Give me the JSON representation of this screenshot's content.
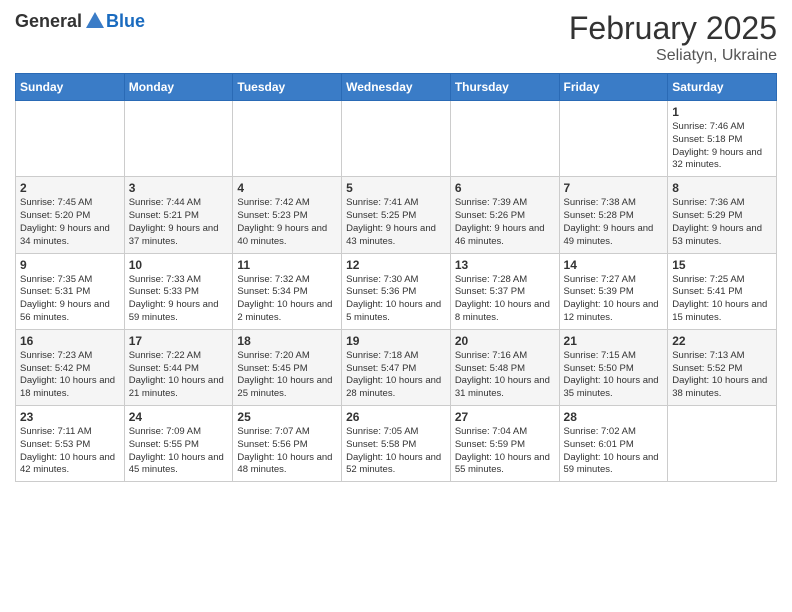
{
  "header": {
    "logo_general": "General",
    "logo_blue": "Blue",
    "title": "February 2025",
    "subtitle": "Seliatyn, Ukraine"
  },
  "days_of_week": [
    "Sunday",
    "Monday",
    "Tuesday",
    "Wednesday",
    "Thursday",
    "Friday",
    "Saturday"
  ],
  "weeks": [
    [
      {
        "day": "",
        "info": ""
      },
      {
        "day": "",
        "info": ""
      },
      {
        "day": "",
        "info": ""
      },
      {
        "day": "",
        "info": ""
      },
      {
        "day": "",
        "info": ""
      },
      {
        "day": "",
        "info": ""
      },
      {
        "day": "1",
        "info": "Sunrise: 7:46 AM\nSunset: 5:18 PM\nDaylight: 9 hours and 32 minutes."
      }
    ],
    [
      {
        "day": "2",
        "info": "Sunrise: 7:45 AM\nSunset: 5:20 PM\nDaylight: 9 hours and 34 minutes."
      },
      {
        "day": "3",
        "info": "Sunrise: 7:44 AM\nSunset: 5:21 PM\nDaylight: 9 hours and 37 minutes."
      },
      {
        "day": "4",
        "info": "Sunrise: 7:42 AM\nSunset: 5:23 PM\nDaylight: 9 hours and 40 minutes."
      },
      {
        "day": "5",
        "info": "Sunrise: 7:41 AM\nSunset: 5:25 PM\nDaylight: 9 hours and 43 minutes."
      },
      {
        "day": "6",
        "info": "Sunrise: 7:39 AM\nSunset: 5:26 PM\nDaylight: 9 hours and 46 minutes."
      },
      {
        "day": "7",
        "info": "Sunrise: 7:38 AM\nSunset: 5:28 PM\nDaylight: 9 hours and 49 minutes."
      },
      {
        "day": "8",
        "info": "Sunrise: 7:36 AM\nSunset: 5:29 PM\nDaylight: 9 hours and 53 minutes."
      }
    ],
    [
      {
        "day": "9",
        "info": "Sunrise: 7:35 AM\nSunset: 5:31 PM\nDaylight: 9 hours and 56 minutes."
      },
      {
        "day": "10",
        "info": "Sunrise: 7:33 AM\nSunset: 5:33 PM\nDaylight: 9 hours and 59 minutes."
      },
      {
        "day": "11",
        "info": "Sunrise: 7:32 AM\nSunset: 5:34 PM\nDaylight: 10 hours and 2 minutes."
      },
      {
        "day": "12",
        "info": "Sunrise: 7:30 AM\nSunset: 5:36 PM\nDaylight: 10 hours and 5 minutes."
      },
      {
        "day": "13",
        "info": "Sunrise: 7:28 AM\nSunset: 5:37 PM\nDaylight: 10 hours and 8 minutes."
      },
      {
        "day": "14",
        "info": "Sunrise: 7:27 AM\nSunset: 5:39 PM\nDaylight: 10 hours and 12 minutes."
      },
      {
        "day": "15",
        "info": "Sunrise: 7:25 AM\nSunset: 5:41 PM\nDaylight: 10 hours and 15 minutes."
      }
    ],
    [
      {
        "day": "16",
        "info": "Sunrise: 7:23 AM\nSunset: 5:42 PM\nDaylight: 10 hours and 18 minutes."
      },
      {
        "day": "17",
        "info": "Sunrise: 7:22 AM\nSunset: 5:44 PM\nDaylight: 10 hours and 21 minutes."
      },
      {
        "day": "18",
        "info": "Sunrise: 7:20 AM\nSunset: 5:45 PM\nDaylight: 10 hours and 25 minutes."
      },
      {
        "day": "19",
        "info": "Sunrise: 7:18 AM\nSunset: 5:47 PM\nDaylight: 10 hours and 28 minutes."
      },
      {
        "day": "20",
        "info": "Sunrise: 7:16 AM\nSunset: 5:48 PM\nDaylight: 10 hours and 31 minutes."
      },
      {
        "day": "21",
        "info": "Sunrise: 7:15 AM\nSunset: 5:50 PM\nDaylight: 10 hours and 35 minutes."
      },
      {
        "day": "22",
        "info": "Sunrise: 7:13 AM\nSunset: 5:52 PM\nDaylight: 10 hours and 38 minutes."
      }
    ],
    [
      {
        "day": "23",
        "info": "Sunrise: 7:11 AM\nSunset: 5:53 PM\nDaylight: 10 hours and 42 minutes."
      },
      {
        "day": "24",
        "info": "Sunrise: 7:09 AM\nSunset: 5:55 PM\nDaylight: 10 hours and 45 minutes."
      },
      {
        "day": "25",
        "info": "Sunrise: 7:07 AM\nSunset: 5:56 PM\nDaylight: 10 hours and 48 minutes."
      },
      {
        "day": "26",
        "info": "Sunrise: 7:05 AM\nSunset: 5:58 PM\nDaylight: 10 hours and 52 minutes."
      },
      {
        "day": "27",
        "info": "Sunrise: 7:04 AM\nSunset: 5:59 PM\nDaylight: 10 hours and 55 minutes."
      },
      {
        "day": "28",
        "info": "Sunrise: 7:02 AM\nSunset: 6:01 PM\nDaylight: 10 hours and 59 minutes."
      },
      {
        "day": "",
        "info": ""
      }
    ]
  ]
}
